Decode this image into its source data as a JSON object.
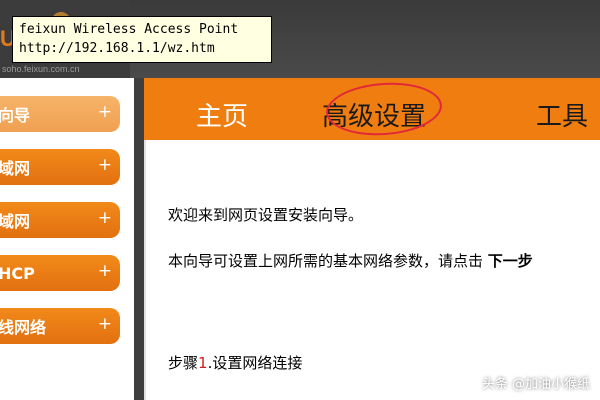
{
  "tooltip": {
    "line1": "feixun Wireless Access Point",
    "line2": "http://192.168.1.1/wz.htm"
  },
  "header": {
    "logo_sub": "soho.feixun.com.cn",
    "logo_mark": "U"
  },
  "sidebar": {
    "items": [
      {
        "label": "向导",
        "plus": "+"
      },
      {
        "label": "域网",
        "plus": "+"
      },
      {
        "label": "域网",
        "plus": "+"
      },
      {
        "label": "HCP",
        "plus": "+"
      },
      {
        "label": "线网络",
        "plus": "+"
      }
    ]
  },
  "topnav": {
    "items": [
      {
        "label": "主页"
      },
      {
        "label": "高级设置"
      },
      {
        "label": "工具"
      }
    ]
  },
  "content": {
    "welcome": "欢迎来到网页设置安装向导。",
    "instruction": "本向导可设置上网所需的基本网络参数，请点击",
    "next_label": "下一步",
    "step_prefix": "步骤",
    "step_num": "1",
    "step_text": ".设置网络连接"
  },
  "watermark": "头条 @加油小猴纸",
  "colors": {
    "accent": "#f07d10",
    "header": "#3c3c3c",
    "highlight_circle": "#e0283a"
  }
}
